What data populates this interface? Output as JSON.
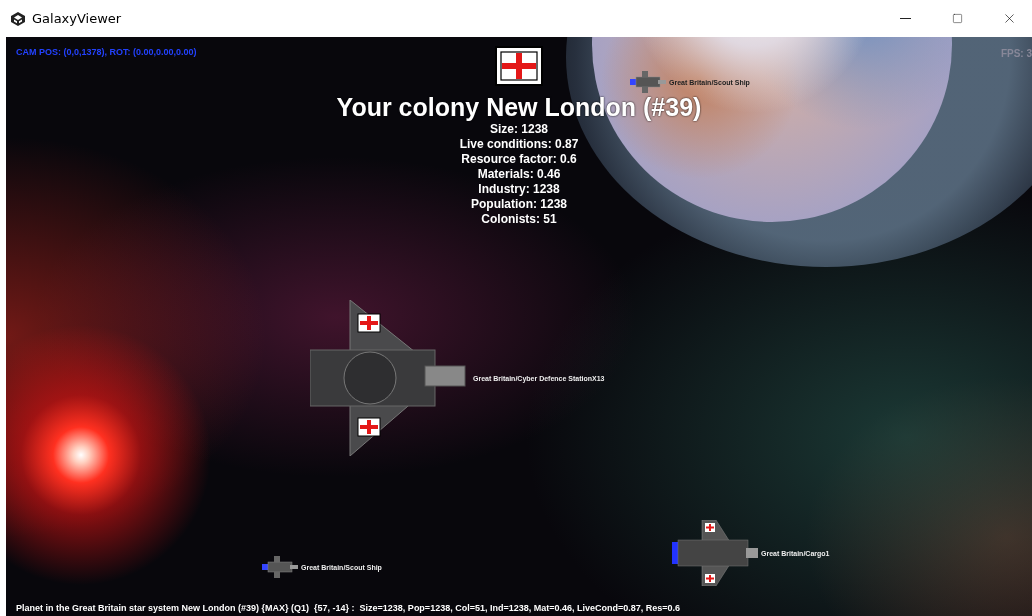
{
  "window": {
    "title": "GalaxyViewer"
  },
  "hud": {
    "camera": "CAM POS: (0,0,1378), ROT: (0.00,0.00,0.00)",
    "fps": "FPS: 3"
  },
  "colony": {
    "title": "Your colony New London (#39)",
    "stats": [
      "Size: 1238",
      "Live conditions: 0.87",
      "Resource factor: 0.6",
      "Materials: 0.46",
      "Industry: 1238",
      "Population: 1238",
      "Colonists: 51"
    ]
  },
  "ships": [
    {
      "kind": "scout",
      "label": "Great Britain/Scout Ship"
    },
    {
      "kind": "station",
      "label": "Great Britain/Cyber Defence StationX13"
    },
    {
      "kind": "scout",
      "label": "Great Britain/Scout Ship"
    },
    {
      "kind": "cargo",
      "label": "Great Britain/Cargo1"
    }
  ],
  "status_bar": "Planet in the Great Britain star system New London (#39) {MAX} (Q1)  {57, -14} :  Size=1238, Pop=1238, Col=51, Ind=1238, Mat=0.46, LiveCond=0.87, Res=0.6"
}
